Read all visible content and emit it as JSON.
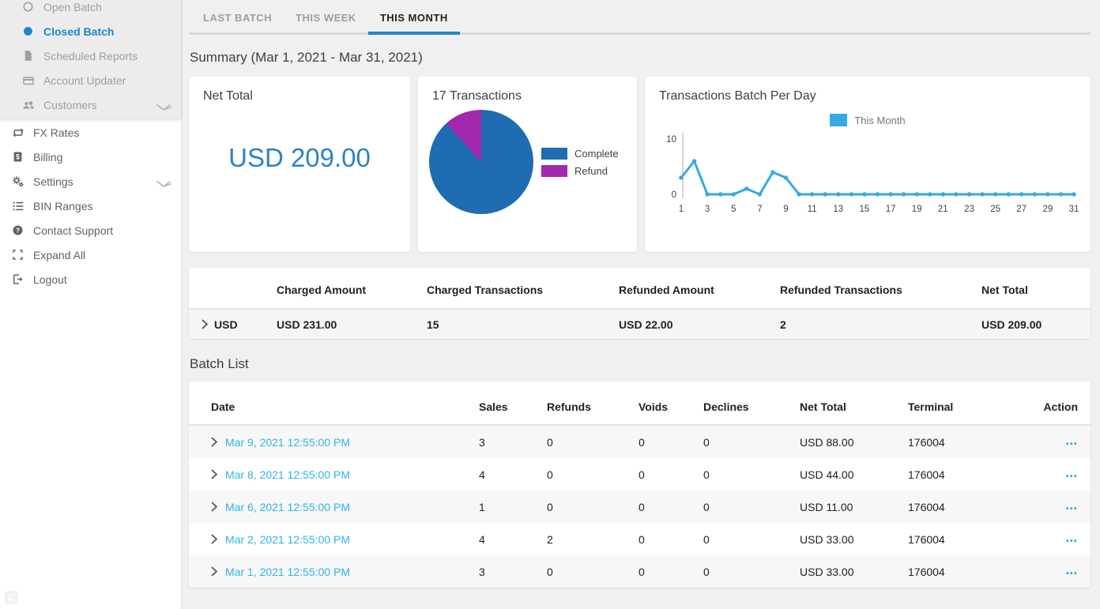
{
  "brand": {
    "logo_letter": "C"
  },
  "colors": {
    "accent_blue": "#1b87ca",
    "tab_underline": "#1e88c7",
    "net_value_blue": "#2e82c4",
    "pie_complete": "#1f6cb2",
    "pie_refund": "#a228ad",
    "line_blue": "#36a9e1",
    "link_blue": "#30b3ea"
  },
  "sidebar": {
    "submenu": [
      {
        "label": "Open Batch",
        "icon": "open-circle-icon",
        "active": false,
        "chevron": false
      },
      {
        "label": "Closed Batch",
        "icon": "filled-circle-icon",
        "active": true,
        "chevron": false
      },
      {
        "label": "Scheduled Reports",
        "icon": "document-icon",
        "active": false,
        "chevron": false
      },
      {
        "label": "Account Updater",
        "icon": "credit-card-icon",
        "active": false,
        "chevron": false
      },
      {
        "label": "Customers",
        "icon": "users-icon",
        "active": false,
        "chevron": true
      }
    ],
    "menu": [
      {
        "label": "FX Rates",
        "icon": "exchange-icon",
        "chevron": false
      },
      {
        "label": "Billing",
        "icon": "billing-icon",
        "chevron": false
      },
      {
        "label": "Settings",
        "icon": "gears-icon",
        "chevron": true
      },
      {
        "label": "BIN Ranges",
        "icon": "list-icon",
        "chevron": false
      },
      {
        "label": "Contact Support",
        "icon": "help-icon",
        "chevron": false
      },
      {
        "label": "Expand All",
        "icon": "expand-icon",
        "chevron": false
      },
      {
        "label": "Logout",
        "icon": "logout-icon",
        "chevron": false
      }
    ]
  },
  "tabs": [
    {
      "label": "LAST BATCH",
      "active": false
    },
    {
      "label": "THIS WEEK",
      "active": false
    },
    {
      "label": "THIS MONTH",
      "active": true
    }
  ],
  "summary_heading": "Summary (Mar 1, 2021 - Mar 31, 2021)",
  "cards": {
    "net_total": {
      "title": "Net Total",
      "value": "USD 209.00"
    },
    "transactions": {
      "title": "17 Transactions"
    },
    "per_day": {
      "title": "Transactions Batch Per Day",
      "legend_label": "This Month"
    }
  },
  "chart_data": [
    {
      "type": "pie",
      "title": "17 Transactions",
      "labels": [
        "Complete",
        "Refund"
      ],
      "values": [
        15,
        2
      ],
      "colors": [
        "#1f6cb2",
        "#a228ad"
      ],
      "legend_position": "right"
    },
    {
      "type": "line",
      "title": "Transactions Batch Per Day",
      "x": [
        1,
        2,
        3,
        4,
        5,
        6,
        7,
        8,
        9,
        10,
        11,
        12,
        13,
        14,
        15,
        16,
        17,
        18,
        19,
        20,
        21,
        22,
        23,
        24,
        25,
        26,
        27,
        28,
        29,
        30,
        31
      ],
      "series": [
        {
          "name": "This Month",
          "values": [
            3,
            6,
            0,
            0,
            0,
            1,
            0,
            4,
            3,
            0,
            0,
            0,
            0,
            0,
            0,
            0,
            0,
            0,
            0,
            0,
            0,
            0,
            0,
            0,
            0,
            0,
            0,
            0,
            0,
            0,
            0
          ]
        }
      ],
      "xticks": [
        1,
        3,
        5,
        7,
        9,
        11,
        13,
        15,
        17,
        19,
        21,
        23,
        25,
        27,
        29,
        31
      ],
      "ylim": [
        0,
        10
      ],
      "yticks": [
        0,
        10
      ],
      "color": "#36a9e1",
      "grid": false,
      "legend_position": "top"
    }
  ],
  "summary_table": {
    "headers": [
      "",
      "Charged Amount",
      "Charged Transactions",
      "Refunded Amount",
      "Refunded Transactions",
      "Net Total"
    ],
    "rows": [
      {
        "currency": "USD",
        "charged_amount": "USD 231.00",
        "charged_transactions": "15",
        "refunded_amount": "USD 22.00",
        "refunded_transactions": "2",
        "net_total": "USD 209.00"
      }
    ]
  },
  "batch_list": {
    "heading": "Batch List",
    "headers": [
      "Date",
      "Sales",
      "Refunds",
      "Voids",
      "Declines",
      "Net Total",
      "Terminal",
      "Action"
    ],
    "action_glyph": "•••",
    "rows": [
      {
        "date": "Mar 9, 2021 12:55:00 PM",
        "sales": "3",
        "refunds": "0",
        "voids": "0",
        "declines": "0",
        "net_total": "USD 88.00",
        "terminal": "176004"
      },
      {
        "date": "Mar 8, 2021 12:55:00 PM",
        "sales": "4",
        "refunds": "0",
        "voids": "0",
        "declines": "0",
        "net_total": "USD 44.00",
        "terminal": "176004"
      },
      {
        "date": "Mar 6, 2021 12:55:00 PM",
        "sales": "1",
        "refunds": "0",
        "voids": "0",
        "declines": "0",
        "net_total": "USD 11.00",
        "terminal": "176004"
      },
      {
        "date": "Mar 2, 2021 12:55:00 PM",
        "sales": "4",
        "refunds": "2",
        "voids": "0",
        "declines": "0",
        "net_total": "USD 33.00",
        "terminal": "176004"
      },
      {
        "date": "Mar 1, 2021 12:55:00 PM",
        "sales": "3",
        "refunds": "0",
        "voids": "0",
        "declines": "0",
        "net_total": "USD 33.00",
        "terminal": "176004"
      }
    ]
  }
}
